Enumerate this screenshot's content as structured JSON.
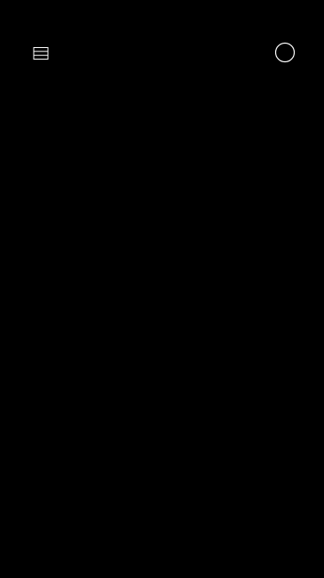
{
  "theme": {
    "background": "#000000",
    "icon_color": "#ffffff"
  },
  "header": {
    "left_icon": "menu-list-icon",
    "right_icon": "circle-profile-icon"
  },
  "main": {
    "content": ""
  }
}
